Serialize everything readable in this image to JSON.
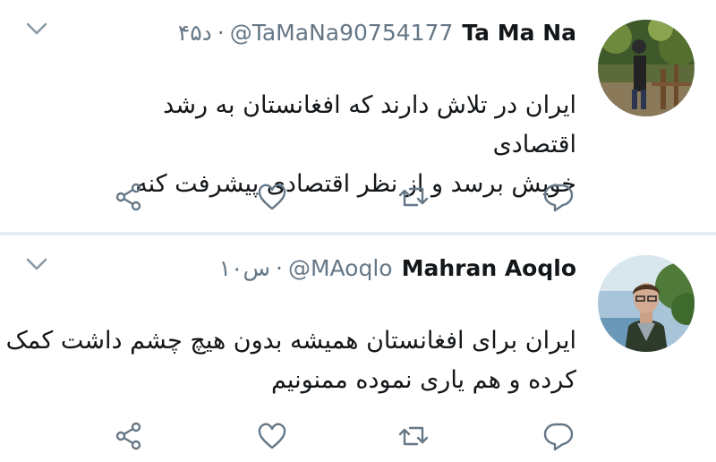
{
  "tweets": [
    {
      "name": "Ta Ma Na",
      "handle": "@TaMaNa90754177",
      "separator": "·",
      "time": "۴۵د",
      "text_line1": "ایران در تلاش دارند که افغانستان به رشد اقتصادی",
      "text_line2": "خویش برسد و از نظر اقتصادی پیشرفت کنه"
    },
    {
      "name": "Mahran Aoqlo",
      "handle": "@MAoqlo",
      "separator": "·",
      "time": "۱۰س",
      "text_line1": "ایران برای افغانستان همیشه بدون هیچ  چشم داشت کمک",
      "text_line2": "کرده و هم یاری نموده ممنونیم"
    }
  ],
  "icons": {
    "more": "chevron-down-icon",
    "share": "share-icon",
    "like": "heart-icon",
    "retweet": "retweet-icon",
    "reply": "reply-icon"
  },
  "colors": {
    "icon": "#657786",
    "text": "#14171a",
    "divider": "#e6ecf0"
  }
}
